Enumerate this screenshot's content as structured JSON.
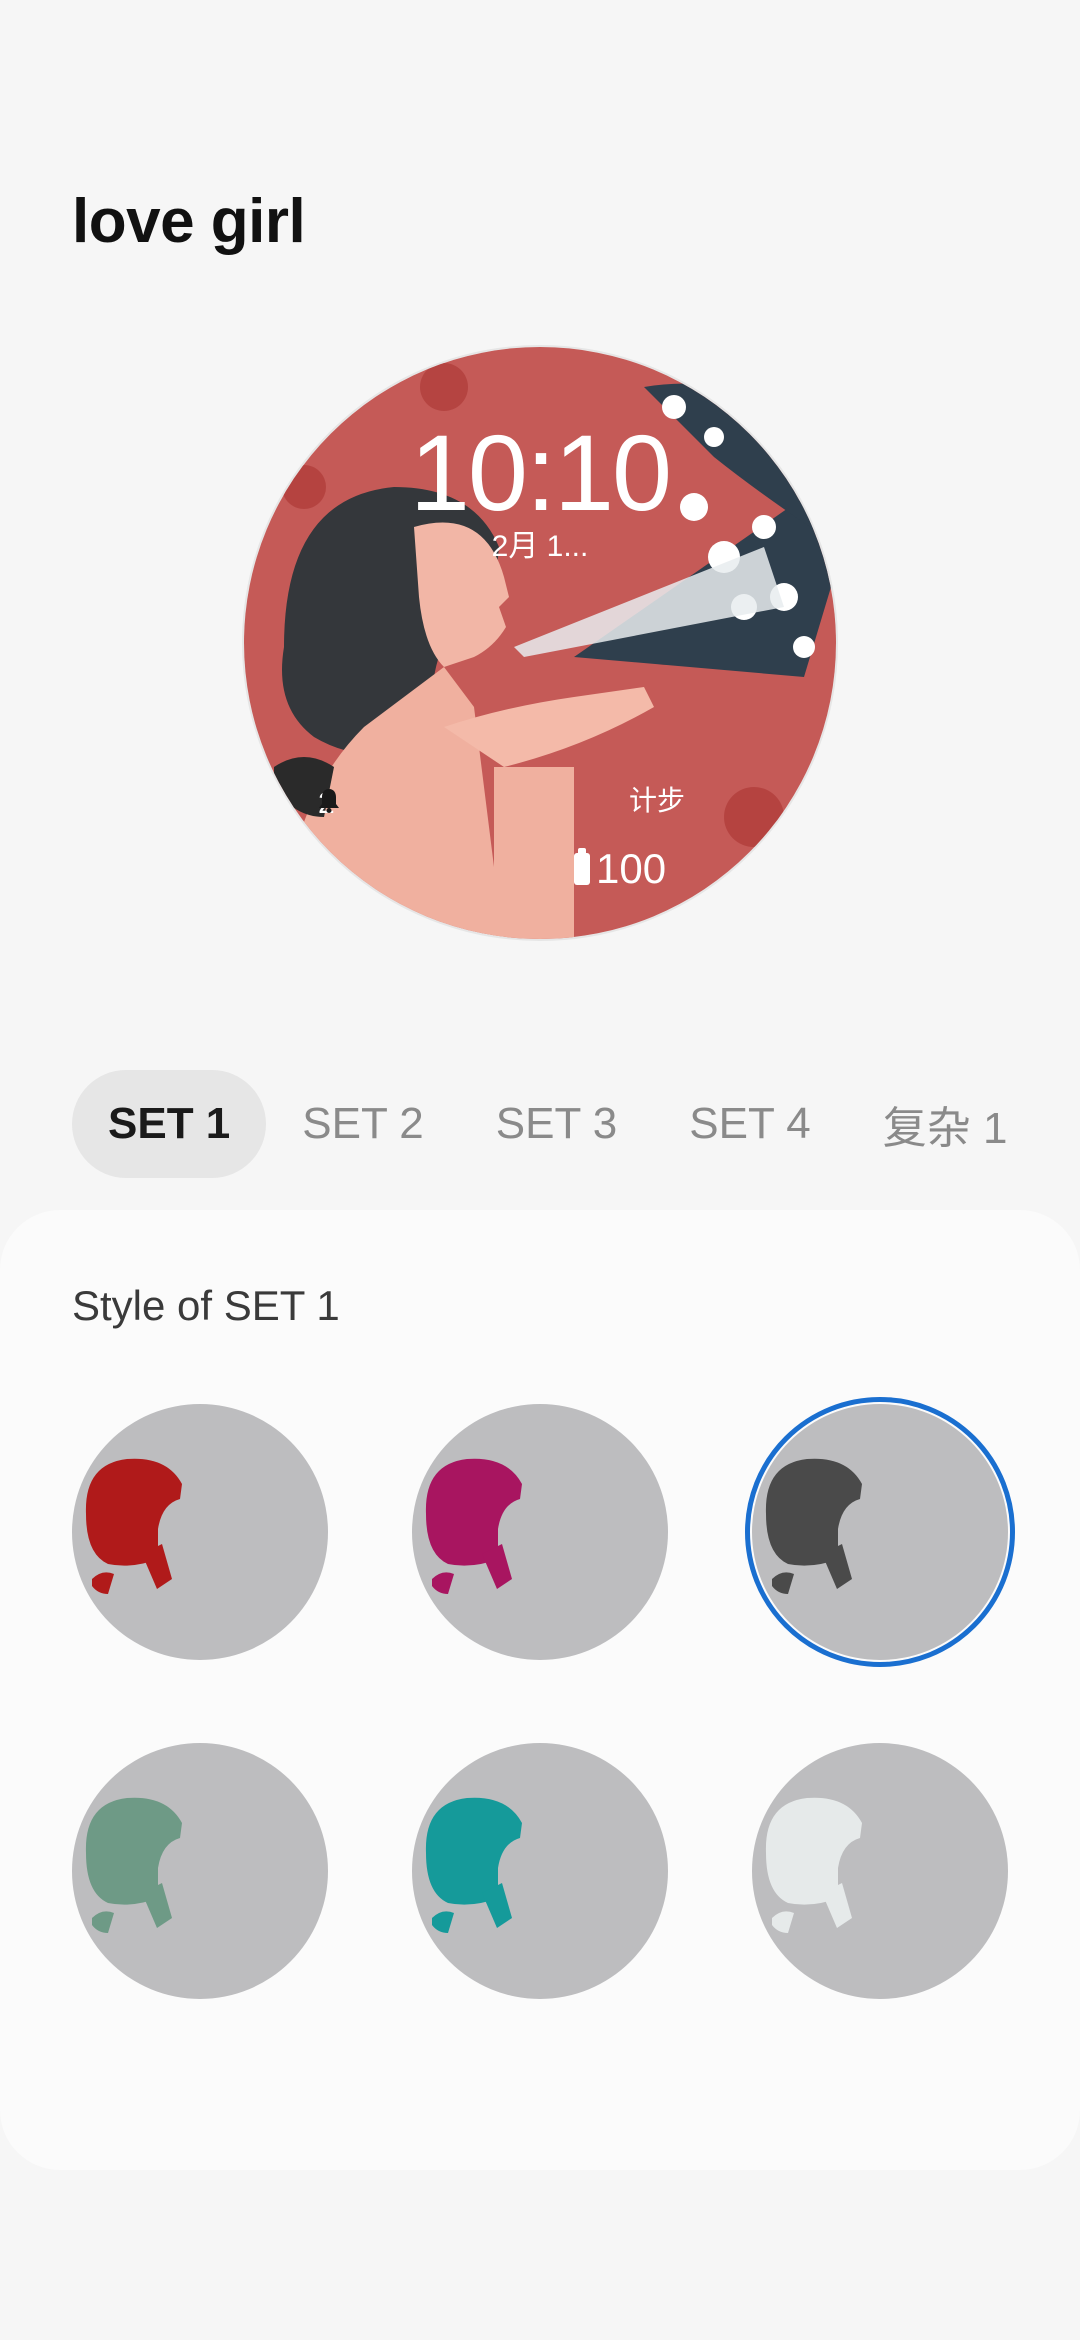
{
  "header": {
    "title": "love girl"
  },
  "watch_preview": {
    "time": "10:10",
    "date": "2月 1...",
    "notification_count": "2",
    "steps_label": "计步",
    "battery": "100",
    "background_color": "#c55a57"
  },
  "tabs": [
    {
      "label": "SET 1",
      "active": true
    },
    {
      "label": "SET 2",
      "active": false
    },
    {
      "label": "SET 3",
      "active": false
    },
    {
      "label": "SET 4",
      "active": false
    },
    {
      "label": "复杂 1",
      "active": false
    }
  ],
  "style_panel": {
    "title": "Style of SET 1",
    "selected_index": 2,
    "swatches": [
      {
        "name": "red",
        "color": "#b01a1a"
      },
      {
        "name": "magenta",
        "color": "#a81560"
      },
      {
        "name": "dark",
        "color": "#4a4a4a"
      },
      {
        "name": "sage",
        "color": "#6e9a86"
      },
      {
        "name": "teal",
        "color": "#159a9a"
      },
      {
        "name": "white",
        "color": "#e6eaea"
      }
    ]
  },
  "accent_color": "#1a6fd0"
}
